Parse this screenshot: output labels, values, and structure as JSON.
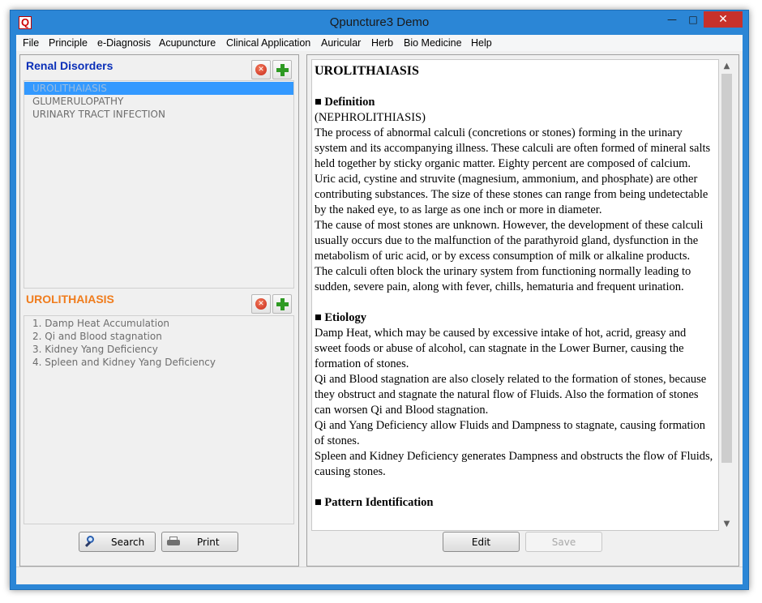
{
  "window": {
    "title": "Qpuncture3 Demo",
    "app_icon_letter": "Q",
    "accent_color": "#2b86d6"
  },
  "menu": [
    {
      "label": "File"
    },
    {
      "label": "Principle"
    },
    {
      "label": "e-Diagnosis"
    },
    {
      "label": "Acupuncture"
    },
    {
      "label": "Clinical Application"
    },
    {
      "label": "Auricular"
    },
    {
      "label": "Herb"
    },
    {
      "label": "Bio Medicine"
    },
    {
      "label": "Help"
    }
  ],
  "disorders": {
    "title": "Renal Disorders",
    "title_color": "#0a2fb8",
    "items": [
      "UROLITHAIASIS",
      "GLUMERULOPATHY",
      "URINARY TRACT INFECTION"
    ],
    "selected_index": 0
  },
  "patterns": {
    "title": "UROLITHAIASIS",
    "title_color": "#f07c1c",
    "items": [
      "1. Damp Heat Accumulation",
      "2. Qi and Blood stagnation",
      "3. Kidney Yang Deficiency",
      "4. Spleen and Kidney Yang Deficiency"
    ]
  },
  "buttons": {
    "search": "Search",
    "print": "Print",
    "edit": "Edit",
    "save": "Save"
  },
  "document": {
    "title": "UROLITHAIASIS",
    "definition_heading": "■ Definition",
    "definition_alt": "(NEPHROLITHIASIS)",
    "definition_p1": " The process of abnormal calculi (concretions or stones) forming in the urinary system and its accompanying illness.  These calculi are often formed of mineral salts held together by sticky organic matter.  Eighty percent are composed of calcium.  Uric acid, cystine and struvite (magnesium, ammonium, and phosphate) are other contributing substances. The size of these stones can range from being undetectable by the naked eye, to as large as one inch or more in diameter.",
    "definition_p2": " The cause of most stones are unknown. However, the development of these calculi usually occurs   due to the malfunction of the parathyroid gland, dysfunction in the metabolism of uric acid, or by excess consumption of milk or alkaline products.",
    "definition_p3": " The calculi often block the urinary system from functioning normally leading to sudden, severe pain, along with fever, chills, hematuria and frequent urination.",
    "etiology_heading": "■ Etiology",
    "etiology_p1": " Damp Heat, which may be caused by excessive intake of hot, acrid, greasy and sweet foods or abuse of alcohol, can stagnate in the Lower Burner, causing the formation of stones.",
    "etiology_p2": " Qi and Blood stagnation are also closely related to the formation of stones, because they obstruct and stagnate the natural flow of Fluids.  Also the formation of stones can worsen Qi and Blood stagnation.",
    "etiology_p3": " Qi and Yang Deficiency allow Fluids and Dampness to stagnate, causing formation of stones.",
    "etiology_p4": " Spleen and Kidney Deficiency generates Dampness and obstructs the flow of Fluids, causing stones.",
    "pattern_heading": "■ Pattern Identification"
  }
}
